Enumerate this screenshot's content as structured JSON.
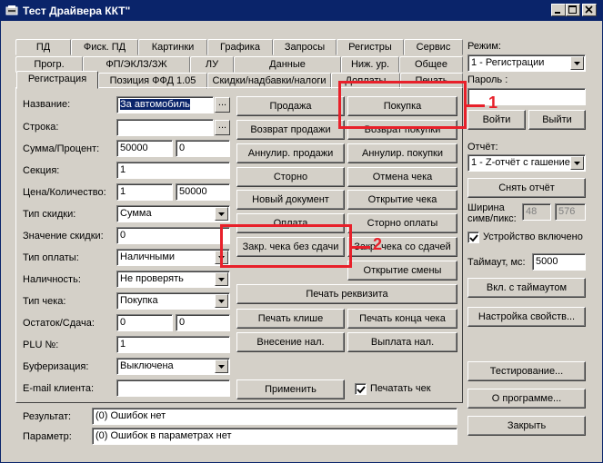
{
  "window": {
    "title": "Тест Драйвера ККТ\""
  },
  "tabs": {
    "row1": [
      "ПД",
      "Фиск. ПД",
      "Картинки",
      "Графика",
      "Запросы",
      "Регистры",
      "Сервис"
    ],
    "row2": [
      "Прогр.",
      "ФП/ЭКЛЗ/ЗЖ",
      "ЛУ",
      "Данные",
      "Ниж. ур.",
      "Общее"
    ],
    "row3": [
      "Регистрация",
      "Позиция ФФД 1.05",
      "Скидки/надбавки/налоги",
      "Доплаты",
      "Печать"
    ],
    "active": "Регистрация"
  },
  "form": {
    "name": {
      "label": "Название:",
      "value": "За автомобиль"
    },
    "line": {
      "label": "Строка:",
      "value": ""
    },
    "sum_percent": {
      "label": "Сумма/Процент:",
      "value1": "50000",
      "value2": "0"
    },
    "section": {
      "label": "Секция:",
      "value": "1"
    },
    "price_qty": {
      "label": "Цена/Количество:",
      "value1": "1",
      "value2": "50000"
    },
    "discount_type": {
      "label": "Тип скидки:",
      "value": "Сумма"
    },
    "discount_value": {
      "label": "Значение скидки:",
      "value": "0"
    },
    "payment_type": {
      "label": "Тип оплаты:",
      "value": "Наличными"
    },
    "cash": {
      "label": "Наличность:",
      "value": "Не проверять"
    },
    "receipt_type": {
      "label": "Тип чека:",
      "value": "Покупка"
    },
    "balance_change": {
      "label": "Остаток/Сдача:",
      "value1": "0",
      "value2": "0"
    },
    "plu": {
      "label": "PLU №:",
      "value": "1"
    },
    "buffering": {
      "label": "Буферизация:",
      "value": "Выключена"
    },
    "email": {
      "label": "E-mail клиента:",
      "value": ""
    },
    "ellipsis": "..."
  },
  "buttons": {
    "sale": "Продажа",
    "purchase": "Покупка",
    "return_sale": "Возврат продажи",
    "return_purchase": "Возврат покупки",
    "cancel_sale": "Аннулир. продажи",
    "cancel_purchase": "Аннулир. покупки",
    "storno": "Сторно",
    "cancel_receipt": "Отмена чека",
    "new_document": "Новый документ",
    "open_receipt": "Открытие чека",
    "payment": "Оплата",
    "storno_payment": "Сторно оплаты",
    "close_no_change": "Закр. чека без сдачи",
    "close_with_change": "Закр. чека со сдачей",
    "open_shift": "Открытие смены",
    "print_requisite": "Печать реквизита",
    "print_cliche": "Печать клише",
    "print_receipt_end": "Печать конца чека",
    "cash_in": "Внесение нал.",
    "cash_out": "Выплата нал.",
    "apply": "Применить",
    "print_receipt_checkbox": "Печатать чек"
  },
  "right": {
    "mode_label": "Режим:",
    "mode_value": "1 - Регистрации",
    "password_label": "Пароль :",
    "password_value": "",
    "login": "Войти",
    "logout": "Выйти",
    "report_label": "Отчёт:",
    "report_value": "1 - Z-отчёт с гашением",
    "take_report": "Снять отчёт",
    "width_label_1": "Ширина",
    "width_label_2": "симв/пикс:",
    "width_chars": "48",
    "width_pixels": "576",
    "device_enabled": "Устройство включено",
    "timeout_label": "Таймаут, мс:",
    "timeout_value": "5000",
    "timeout_enable": "Вкл. с таймаутом",
    "properties": "Настройка свойств...",
    "testing": "Тестирование...",
    "about": "О программе...",
    "close": "Закрыть"
  },
  "status": {
    "result_label": "Результат:",
    "result_value": "(0) Ошибок нет",
    "param_label": "Параметр:",
    "param_value": "(0) Ошибок в параметрах нет"
  },
  "annotations": {
    "callout1": "1",
    "callout2": "2",
    "color": "#e8202a"
  },
  "colors": {
    "titlebar": "#0a246a",
    "face": "#d4d0c8",
    "selection": "#0a246a"
  }
}
